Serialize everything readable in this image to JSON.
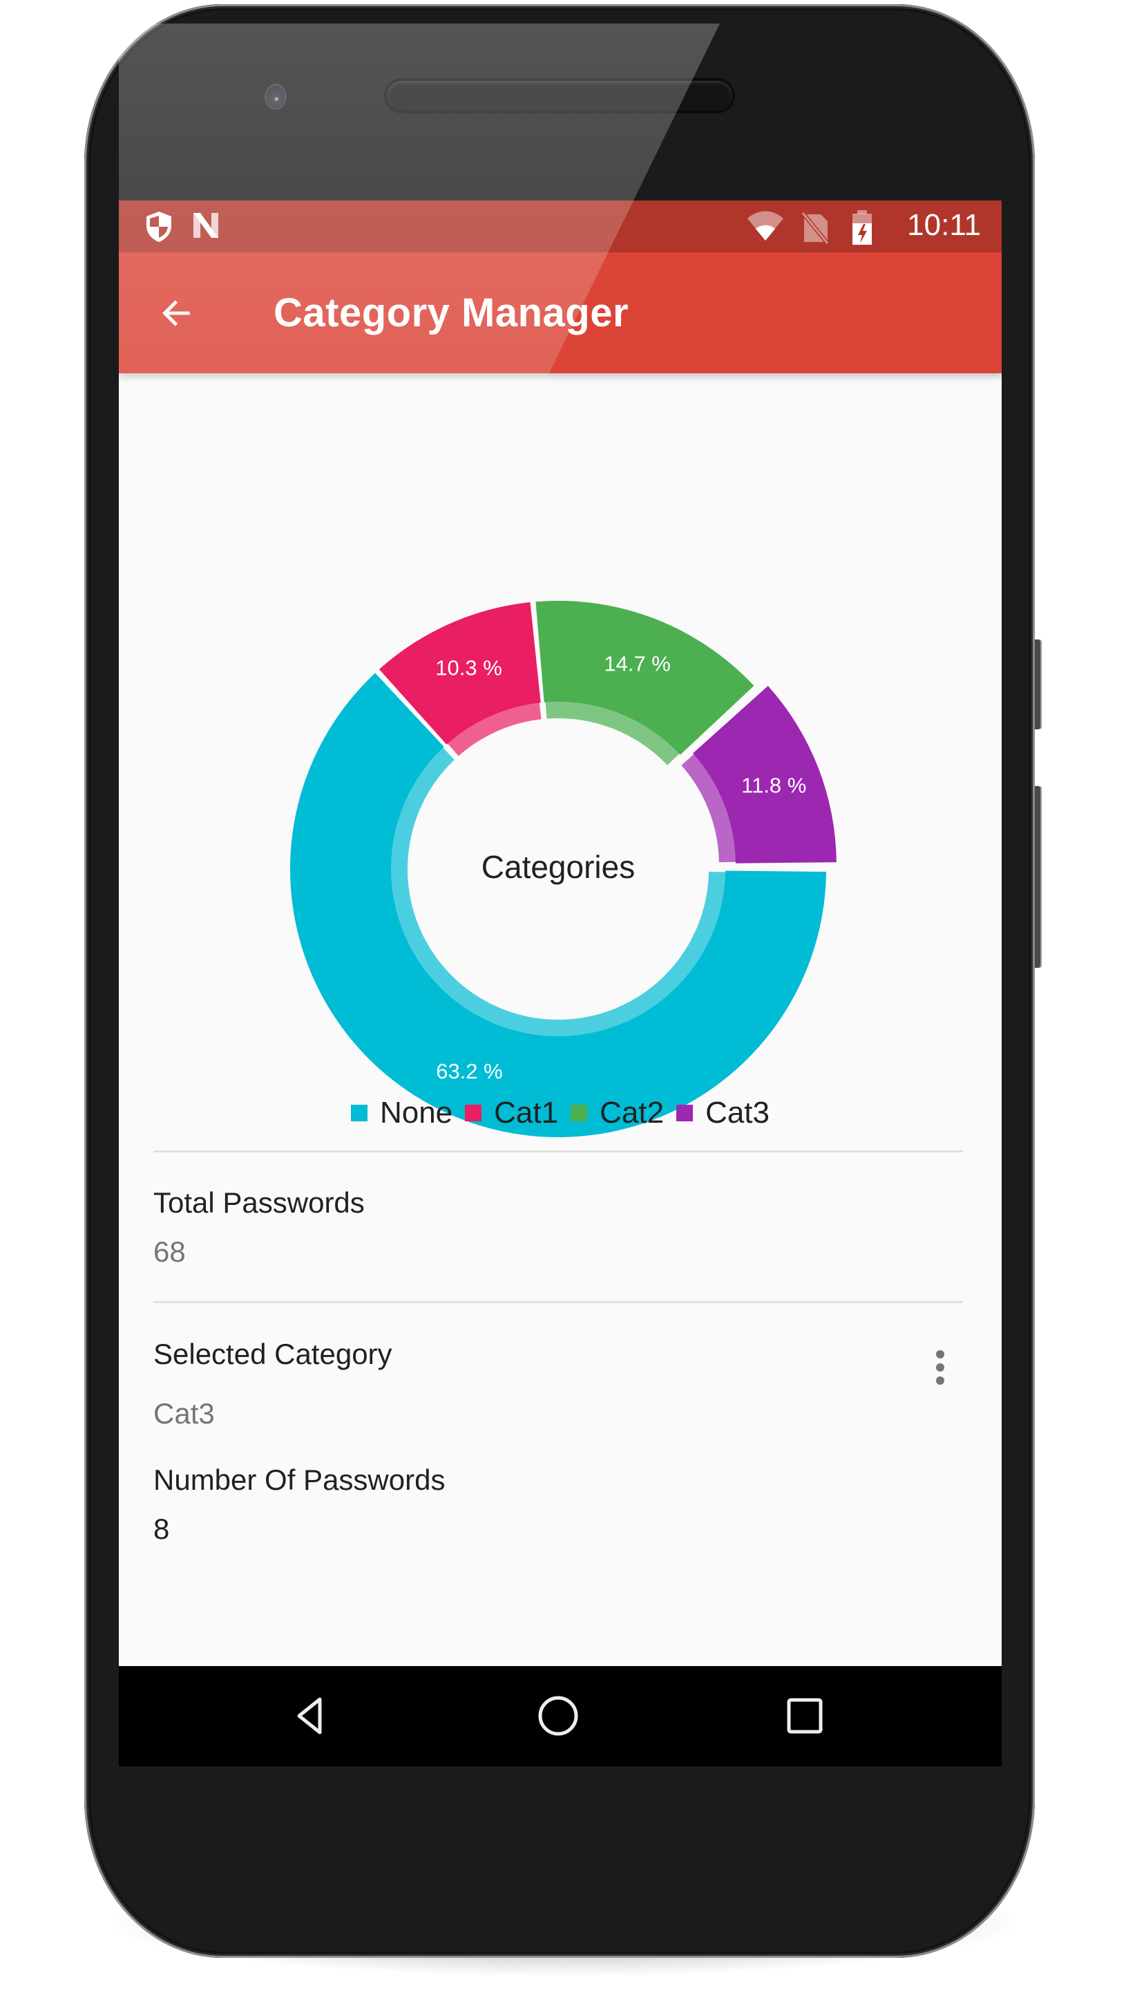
{
  "status_bar": {
    "left_icons": [
      "shield-icon",
      "android-n-icon"
    ],
    "right_icons": [
      "wifi-icon",
      "no-sim-icon",
      "battery-charging-icon"
    ],
    "time": "10:11"
  },
  "toolbar": {
    "back_icon": "arrow-back-icon",
    "title": "Category Manager"
  },
  "colors": {
    "status_bar": "#B0362B",
    "toolbar": "#DB4437",
    "background": "#FAFAFA"
  },
  "chart_data": {
    "type": "pie",
    "variant": "donut",
    "center_text": "Categories",
    "categories": [
      "None",
      "Cat1",
      "Cat2",
      "Cat3"
    ],
    "values": [
      63.2,
      10.3,
      14.7,
      11.8
    ],
    "labels": [
      "63.2 %",
      "10.3 %",
      "14.7 %",
      "11.8 %"
    ],
    "colors": [
      "#00BCD4",
      "#E91E63",
      "#4CAF50",
      "#9C27B0"
    ],
    "selected": "Cat3",
    "legend_position": "bottom-center"
  },
  "legend": [
    {
      "label": "None",
      "color": "#00BCD4"
    },
    {
      "label": "Cat1",
      "color": "#E91E63"
    },
    {
      "label": "Cat2",
      "color": "#4CAF50"
    },
    {
      "label": "Cat3",
      "color": "#9C27B0"
    }
  ],
  "details": {
    "total_passwords_label": "Total Passwords",
    "total_passwords_value": "68",
    "selected_category_label": "Selected Category",
    "selected_category_value": "Cat3",
    "number_of_passwords_label": "Number Of Passwords",
    "number_of_passwords_value": "8",
    "overflow_icon": "more-vert-icon"
  },
  "nav_bar": {
    "buttons": [
      "back-triangle-icon",
      "home-circle-icon",
      "recents-square-icon"
    ]
  }
}
